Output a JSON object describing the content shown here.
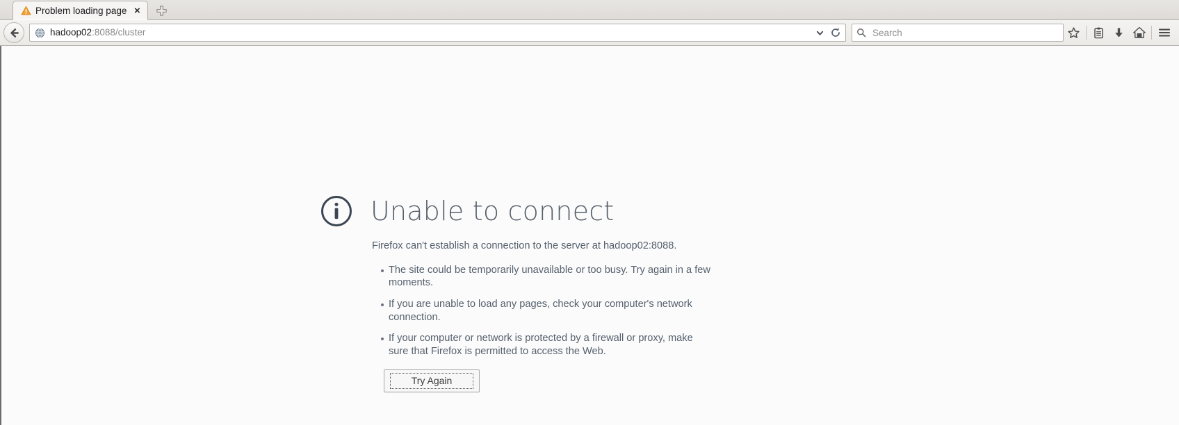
{
  "window": {
    "tabs": [
      {
        "title": "Problem loading page",
        "favicon": "warning-triangle-icon",
        "close_label": "×"
      }
    ],
    "new_tab_label": "+"
  },
  "navbar": {
    "back_label": "Back",
    "url": {
      "host": "hadoop02",
      "path": ":8088/cluster",
      "favicon": "globe-icon"
    },
    "dropdown_label": "Show history",
    "reload_label": "Reload",
    "search": {
      "placeholder": "Search",
      "value": "",
      "icon": "search-icon"
    },
    "buttons": [
      {
        "name": "bookmark-star-button",
        "icon": "star-icon",
        "label": "Bookmark this page"
      },
      {
        "name": "reader-list-button",
        "icon": "clipboard-icon",
        "label": "Reading list"
      },
      {
        "name": "downloads-button",
        "icon": "download-arrow-icon",
        "label": "Downloads"
      },
      {
        "name": "home-button",
        "icon": "home-icon",
        "label": "Home"
      },
      {
        "name": "menu-button",
        "icon": "hamburger-icon",
        "label": "Open menu"
      }
    ]
  },
  "error_page": {
    "icon": "info-circle-icon",
    "title": "Unable to connect",
    "description": "Firefox can't establish a connection to the server at hadoop02:8088.",
    "suggestions": [
      "The site could be temporarily unavailable or too busy. Try again in a few moments.",
      "If you are unable to load any pages, check your computer's network connection.",
      "If your computer or network is protected by a firewall or proxy, make sure that Firefox is permitted to access the Web."
    ],
    "retry_button": "Try Again"
  },
  "colors": {
    "chrome_bg": "#f1f0ee",
    "page_bg": "#fbfbfb",
    "text_slate": "#55606d",
    "warning_orange": "#f0a030"
  }
}
